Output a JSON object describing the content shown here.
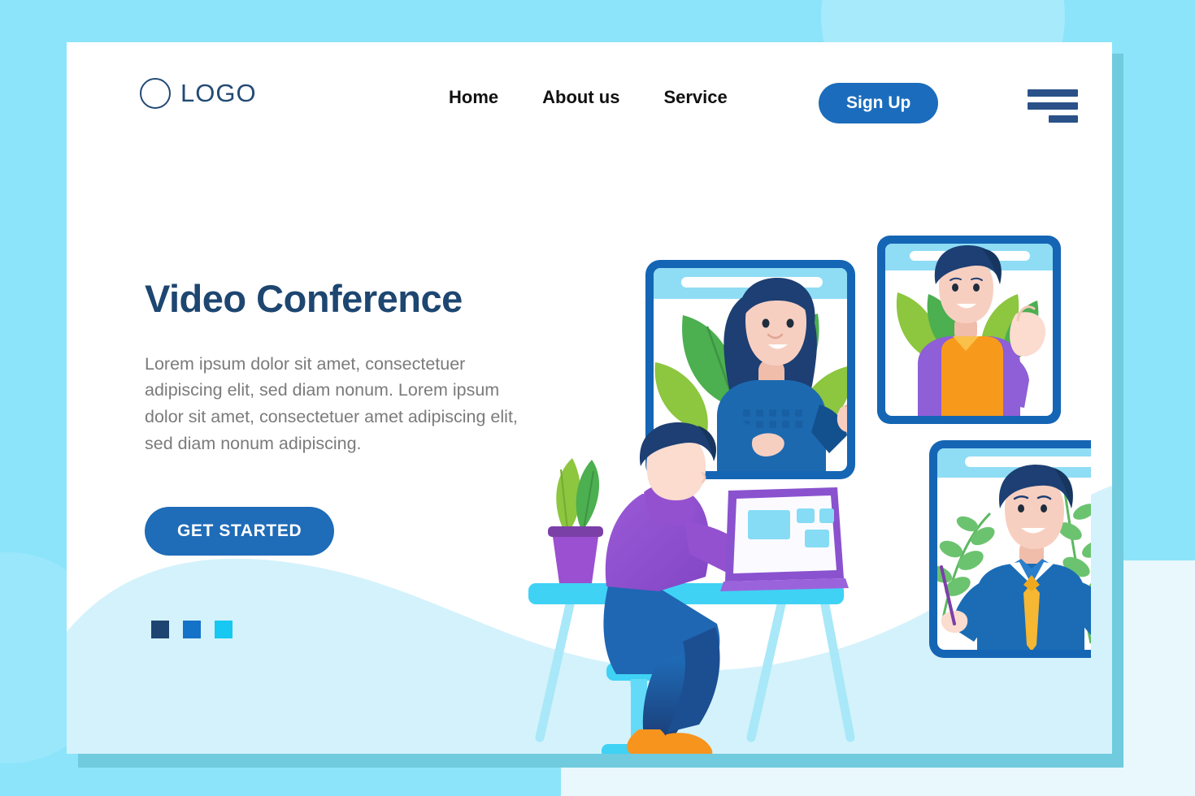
{
  "page": {
    "background_color": "#8ce4fa",
    "card_color": "#ffffff",
    "wave_color": "#d4f2fb",
    "shadow_color": "#6fcbdd"
  },
  "header": {
    "logo": {
      "text": "LOGO",
      "color": "#234a74",
      "icon": "circle-outline-icon"
    },
    "nav": [
      {
        "label": "Home"
      },
      {
        "label": "About us"
      },
      {
        "label": "Service"
      }
    ],
    "signup_button": {
      "label": "Sign Up",
      "bg": "#1b6cbc",
      "text_color": "#ffffff"
    },
    "menu_icon": "hamburger-menu-icon"
  },
  "hero": {
    "title": "Video Conference",
    "title_color": "#1d4670",
    "description": "Lorem ipsum dolor sit amet, consectetuer adipiscing elit, sed diam nonum. Lorem ipsum dolor sit amet, consectetuer amet adipiscing elit, sed diam nonum adipiscing.",
    "description_color": "#7b7b7b",
    "cta_button": {
      "label": "GET STARTED",
      "bg": "#1f6cb8",
      "text_color": "#ffffff"
    },
    "pagination_dots": [
      {
        "name": "dot-1",
        "color": "#1e4471"
      },
      {
        "name": "dot-2",
        "color": "#1472c8"
      },
      {
        "name": "dot-3",
        "color": "#16c8f2"
      }
    ]
  },
  "illustration": {
    "name": "video-conference-illustration",
    "colors": {
      "frame_border": "#1565b5",
      "titlebar": "#8fdcf5",
      "titlebar_pill": "#ffffff",
      "screen_bg": "#ffffff",
      "hair_dark": "#1d3f73",
      "skin": "#f7cfc1",
      "skin_light": "#fbdccf",
      "sweater_blue": "#1c69b0",
      "sweater_blue_dark": "#13518e",
      "shirt_blue": "#1b6cb5",
      "tie_yellow": "#f6b733",
      "vest_orange": "#f79a1c",
      "sleeve_purple": "#8e5fd6",
      "leaf_green": "#4caf50",
      "leaf_green_light": "#8dc63f",
      "desk_cyan": "#3fd2f5",
      "desk_cyan_light": "#a8e8f8",
      "sweater_purple": "#9451cf",
      "jeans_blue": "#1f66b3",
      "shoe_orange": "#f7941e",
      "pot_purple": "#9b4fd1",
      "laptop_purple": "#8a52cf"
    },
    "cards": [
      {
        "name": "participant-card-woman",
        "person": "woman-waving"
      },
      {
        "name": "participant-card-man-orange",
        "person": "man-waving-orange-vest"
      },
      {
        "name": "participant-card-man-suit",
        "person": "man-thumbs-up-suit"
      }
    ],
    "desk_scene": {
      "name": "person-at-desk-with-laptop"
    }
  }
}
